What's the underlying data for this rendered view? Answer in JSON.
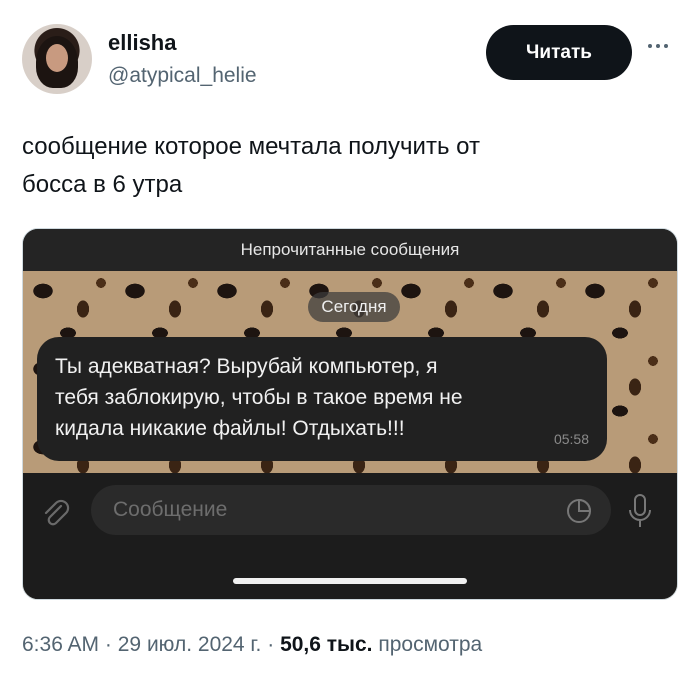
{
  "author": {
    "display_name": "ellisha",
    "handle": "@atypical_helie"
  },
  "follow_label": "Читать",
  "tweet": {
    "text_line1": "сообщение которое мечтала получить от",
    "text_line2": "босса в 6 утра"
  },
  "chat": {
    "unread_label": "Непрочитанные сообщения",
    "day_label": "Сегодня",
    "message_line1": "Ты адекватная? Вырубай компьютер, я",
    "message_line2": "тебя заблокирую, чтобы в такое время не",
    "message_line3": "кидала никакие файлы! Отдыхать!!!",
    "message_time": "05:58",
    "input_placeholder": "Сообщение"
  },
  "meta": {
    "time": "6:36 AM",
    "separator": "·",
    "date": "29 июл. 2024 г.",
    "views_count": "50,6 тыс.",
    "views_label": "просмотра"
  },
  "icons": {
    "more": "more-horizontal-icon",
    "attach": "paperclip-icon",
    "sticker": "sticker-icon",
    "mic": "microphone-icon"
  }
}
